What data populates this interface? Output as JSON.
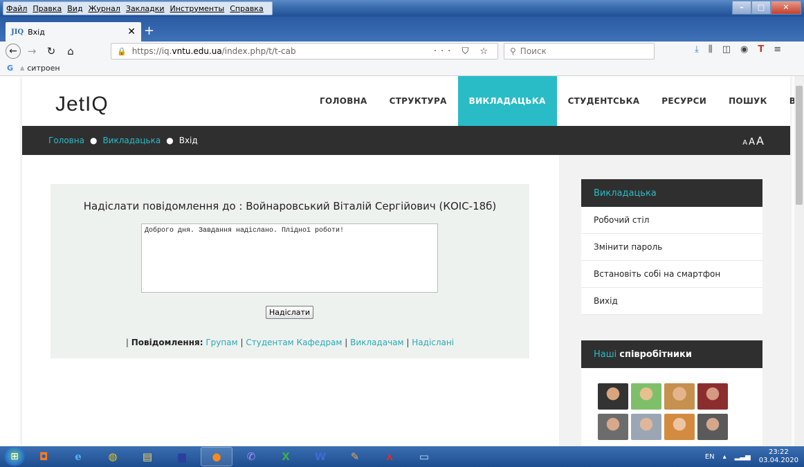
{
  "browser": {
    "menu": [
      "Файл",
      "Правка",
      "Вид",
      "Журнал",
      "Закладки",
      "Инструменты",
      "Справка"
    ],
    "tab": {
      "favicon": "JIQ",
      "title": "Вхід"
    },
    "url_prefix": "https://iq.",
    "url_domain": "vntu.edu.ua",
    "url_path": "/index.php/t/t-cab",
    "url_actions": "··· ⛉ ☆",
    "search_placeholder": "Поиск",
    "bookmark": "ситроен"
  },
  "site": {
    "logo": "JetIQ",
    "nav": [
      "ГОЛОВНА",
      "СТРУКТУРА",
      "ВИКЛАДАЦЬКА",
      "СТУДЕНТСЬКА",
      "РЕСУРСИ",
      "ПОШУК",
      "ВИХІД"
    ],
    "breadcrumb": {
      "home": "Головна",
      "section": "Викладацька",
      "current": "Вхід"
    },
    "font_sizes": [
      "A",
      "A",
      "A"
    ]
  },
  "message": {
    "title": "Надіслати повідомлення до : Войнаровський Віталій Сергійович (КОІС-18б)",
    "text": "Доброго дня. Завдання надіслано. Плідної роботи!",
    "send": "Надіслати",
    "links_label": "Повідомлення:",
    "links": [
      "Групам",
      "Студентам",
      "Кафедрам",
      "Викладачам",
      "Надіслані"
    ]
  },
  "sidebar": {
    "box1": {
      "title": "Викладацька",
      "items": [
        "Робочий стіл",
        "Змінити пароль",
        "Встановіть собі на смартфон",
        "Вихід"
      ]
    },
    "box2": {
      "title_a": "Наші",
      "title_b": "співробітники"
    }
  },
  "taskbar": {
    "lang": "EN",
    "time": "23:22",
    "date": "03.04.2020"
  }
}
